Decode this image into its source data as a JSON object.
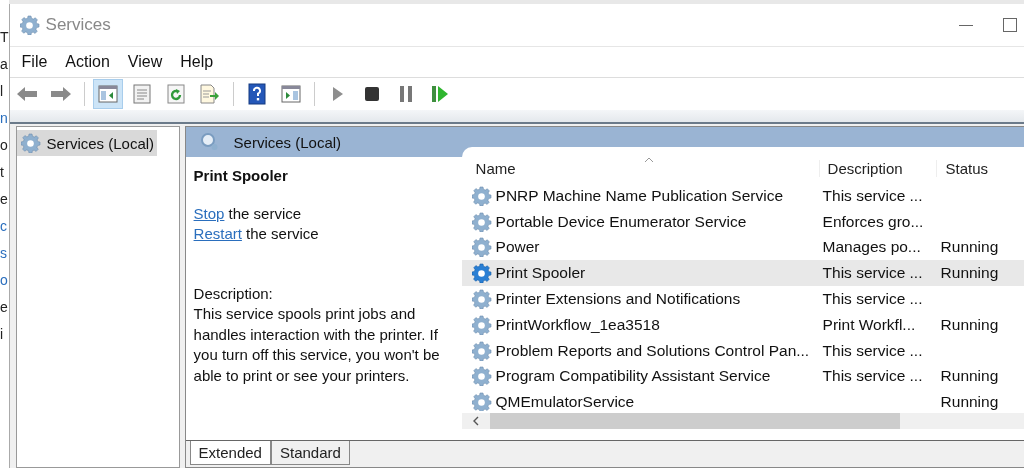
{
  "background_window": {
    "fragments": [
      {
        "text": "T",
        "kind": "text"
      },
      {
        "text": "a",
        "kind": "text"
      },
      {
        "text": "l",
        "kind": "text"
      },
      {
        "text": "n",
        "kind": "link"
      },
      {
        "text": "o",
        "kind": "text"
      },
      {
        "text": "t",
        "kind": "text"
      },
      {
        "text": "e",
        "kind": "text"
      },
      {
        "text": "c",
        "kind": "link"
      },
      {
        "text": "s",
        "kind": "link"
      },
      {
        "text": "o",
        "kind": "link"
      },
      {
        "text": "e",
        "kind": "text"
      },
      {
        "text": "i",
        "kind": "text"
      }
    ]
  },
  "window": {
    "title": "Services"
  },
  "menu": [
    "File",
    "Action",
    "View",
    "Help"
  ],
  "toolbar": [
    [
      {
        "kind": "back",
        "selected": false
      },
      {
        "kind": "forward",
        "selected": false
      }
    ],
    [
      {
        "kind": "console-tree",
        "selected": true
      },
      {
        "kind": "properties",
        "selected": false
      },
      {
        "kind": "refresh",
        "selected": false
      },
      {
        "kind": "export",
        "selected": false
      }
    ],
    [
      {
        "kind": "help",
        "selected": false
      },
      {
        "kind": "action-pane",
        "selected": false
      }
    ],
    [
      {
        "kind": "start",
        "selected": false
      },
      {
        "kind": "stop",
        "selected": false
      },
      {
        "kind": "pause",
        "selected": false
      },
      {
        "kind": "restart",
        "selected": false
      }
    ]
  ],
  "tree": {
    "items": [
      {
        "label": "Services (Local)",
        "selected": true
      }
    ]
  },
  "pane": {
    "header": "Services (Local)",
    "detail": {
      "title": "Print Spooler",
      "actions": [
        {
          "link": "Stop",
          "text": "the service"
        },
        {
          "link": "Restart",
          "text": "the service"
        }
      ],
      "description_label": "Description:",
      "description": "This service spools print jobs and handles interaction with the printer. If you turn off this service, you won't be able to print or see your printers."
    },
    "columns": [
      "Name",
      "Description",
      "Status"
    ],
    "rows": [
      {
        "name": "PNRP Machine Name Publication Service",
        "description": "This service ...",
        "status": "",
        "selected": false
      },
      {
        "name": "Portable Device Enumerator Service",
        "description": "Enforces gro...",
        "status": "",
        "selected": false
      },
      {
        "name": "Power",
        "description": "Manages po...",
        "status": "Running",
        "selected": false
      },
      {
        "name": "Print Spooler",
        "description": "This service ...",
        "status": "Running",
        "selected": true
      },
      {
        "name": "Printer Extensions and Notifications",
        "description": "This service ...",
        "status": "",
        "selected": false
      },
      {
        "name": "PrintWorkflow_1ea3518",
        "description": "Print Workfl...",
        "status": "Running",
        "selected": false
      },
      {
        "name": "Problem Reports and Solutions Control Pan...",
        "description": "This service ...",
        "status": "",
        "selected": false
      },
      {
        "name": "Program Compatibility Assistant Service",
        "description": "This service ...",
        "status": "Running",
        "selected": false
      },
      {
        "name": "QMEmulatorService",
        "description": "",
        "status": "Running",
        "selected": false
      }
    ],
    "tabs": [
      {
        "label": "Extended",
        "selected": true
      },
      {
        "label": "Standard",
        "selected": false
      }
    ]
  }
}
